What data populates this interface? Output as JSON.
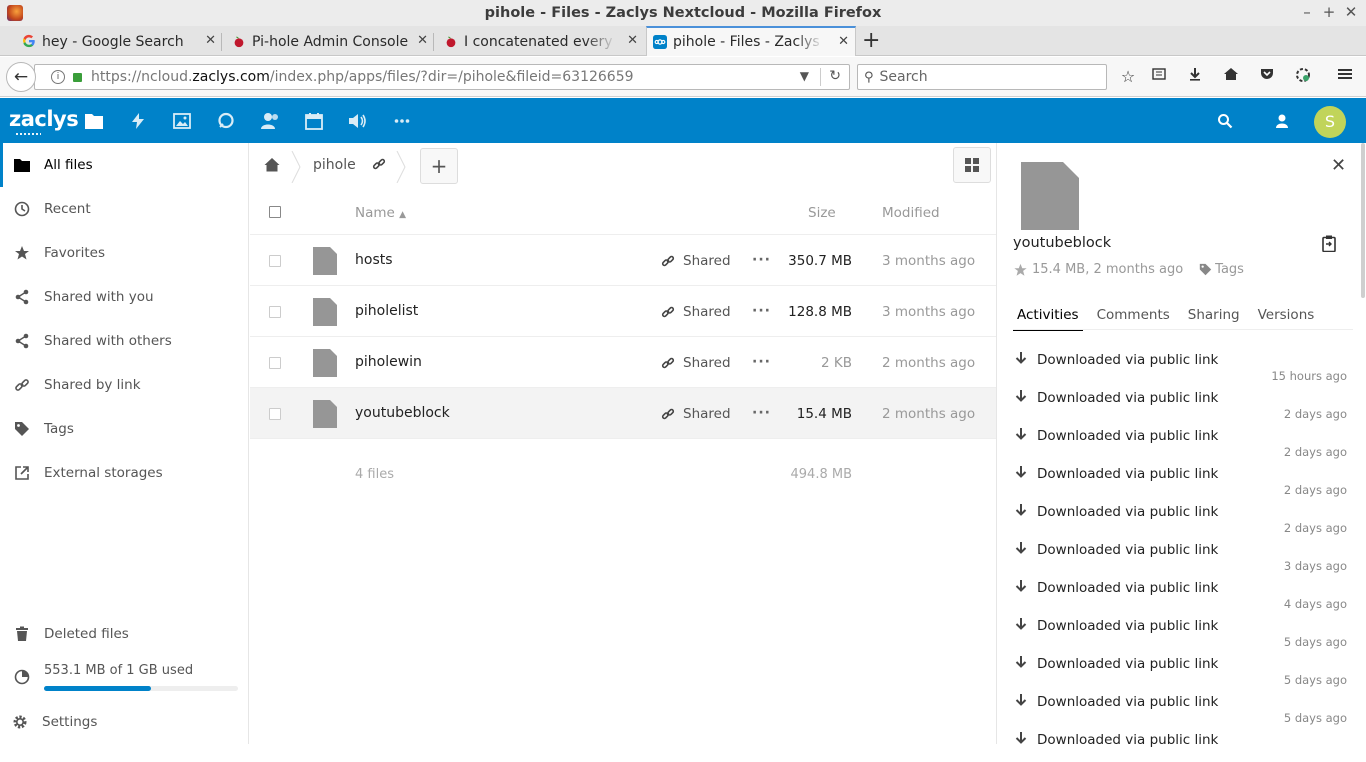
{
  "window": {
    "title": "pihole - Files - Zaclys Nextcloud - Mozilla Firefox"
  },
  "tabs": [
    {
      "label": "hey - Google Search"
    },
    {
      "label": "Pi-hole Admin Console"
    },
    {
      "label": "I concatenated every Bl"
    },
    {
      "label": "pihole - Files - Zaclys Ne"
    }
  ],
  "nav": {
    "url_prefix": "https://ncloud.",
    "url_domain": "zaclys.com",
    "url_rest": "/index.php/apps/files/?dir=/pihole&fileid=63126659",
    "search_placeholder": "Search"
  },
  "header": {
    "logo": "zaclys",
    "avatar_letter": "S"
  },
  "sidebar": {
    "items": [
      {
        "label": "All files",
        "icon": "folder-icon"
      },
      {
        "label": "Recent",
        "icon": "clock-icon"
      },
      {
        "label": "Favorites",
        "icon": "star-icon"
      },
      {
        "label": "Shared with you",
        "icon": "share-icon"
      },
      {
        "label": "Shared with others",
        "icon": "share-icon"
      },
      {
        "label": "Shared by link",
        "icon": "link-icon"
      },
      {
        "label": "Tags",
        "icon": "tag-icon"
      },
      {
        "label": "External storages",
        "icon": "external-icon"
      }
    ],
    "deleted": "Deleted files",
    "quota_text": "553.1 MB of 1 GB used",
    "quota_fraction": 0.553,
    "settings": "Settings"
  },
  "files": {
    "breadcrumb": "pihole",
    "headers": {
      "name": "Name",
      "size": "Size",
      "modified": "Modified"
    },
    "rows": [
      {
        "name": "hosts",
        "share": "Shared",
        "size": "350.7 MB",
        "modified": "3 months ago"
      },
      {
        "name": "piholelist",
        "share": "Shared",
        "size": "128.8 MB",
        "modified": "3 months ago"
      },
      {
        "name": "piholewin",
        "share": "Shared",
        "size": "2 KB",
        "modified": "2 months ago"
      },
      {
        "name": "youtubeblock",
        "share": "Shared",
        "size": "15.4 MB",
        "modified": "2 months ago"
      }
    ],
    "summary": {
      "count": "4 files",
      "total": "494.8 MB"
    }
  },
  "details": {
    "name": "youtubeblock",
    "meta": "15.4 MB, 2 months ago",
    "tags": "Tags",
    "tabs": [
      "Activities",
      "Comments",
      "Sharing",
      "Versions"
    ],
    "activities": [
      {
        "text": "Downloaded via public link",
        "when": "15 hours ago"
      },
      {
        "text": "Downloaded via public link",
        "when": "2 days ago"
      },
      {
        "text": "Downloaded via public link",
        "when": "2 days ago"
      },
      {
        "text": "Downloaded via public link",
        "when": "2 days ago"
      },
      {
        "text": "Downloaded via public link",
        "when": "2 days ago"
      },
      {
        "text": "Downloaded via public link",
        "when": "3 days ago"
      },
      {
        "text": "Downloaded via public link",
        "when": "4 days ago"
      },
      {
        "text": "Downloaded via public link",
        "when": "5 days ago"
      },
      {
        "text": "Downloaded via public link",
        "when": "5 days ago"
      },
      {
        "text": "Downloaded via public link",
        "when": "5 days ago"
      },
      {
        "text": "Downloaded via public link",
        "when": ""
      }
    ]
  }
}
